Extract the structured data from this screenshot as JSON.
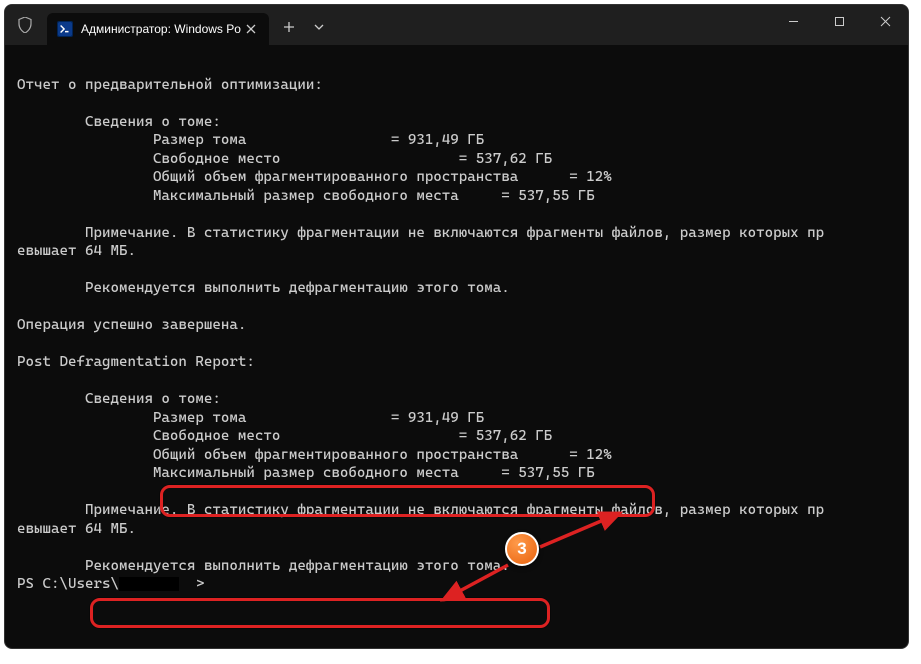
{
  "titlebar": {
    "tab_title": "Администратор: Windows Po",
    "powershell_abbrev": ">_"
  },
  "terminal": {
    "lines": {
      "l0": "",
      "l1": "Отчет о предварительной оптимизации:",
      "l2": "",
      "l3": "        Сведения о томе:",
      "l4": "                Размер тома                 = 931,49 ГБ",
      "l5": "                Свободное место                     = 537,62 ГБ",
      "l6": "                Общий объем фрагментированного пространства      = 12%",
      "l7": "                Максимальный размер свободного места     = 537,55 ГБ",
      "l8": "",
      "l9": "        Примечание. В статистику фрагментации не включаются фрагменты файлов, размер которых пр",
      "l10": "евышает 64 МБ.",
      "l11": "",
      "l12": "        Рекомендуется выполнить дефрагментацию этого тома.",
      "l13": "",
      "l14": "Операция успешно завершена.",
      "l15": "",
      "l16": "Post Defragmentation Report:",
      "l17": "",
      "l18": "        Сведения о томе:",
      "l19": "                Размер тома                 = 931,49 ГБ",
      "l20": "                Свободное место                     = 537,62 ГБ",
      "l21": "                Общий объем фрагментированного пространства      = 12%",
      "l22": "                Максимальный размер свободного места     = 537,55 ГБ",
      "l23": "",
      "l24": "        Примечание. В статистику фрагментации не включаются фрагменты файлов, размер которых пр",
      "l25": "евышает 64 МБ.",
      "l26": "",
      "l27": "        Рекомендуется выполнить дефрагментацию этого тома.",
      "prompt": "PS C:\\Users\\",
      "prompt_end": "  >"
    }
  },
  "annotation": {
    "number": "3"
  }
}
